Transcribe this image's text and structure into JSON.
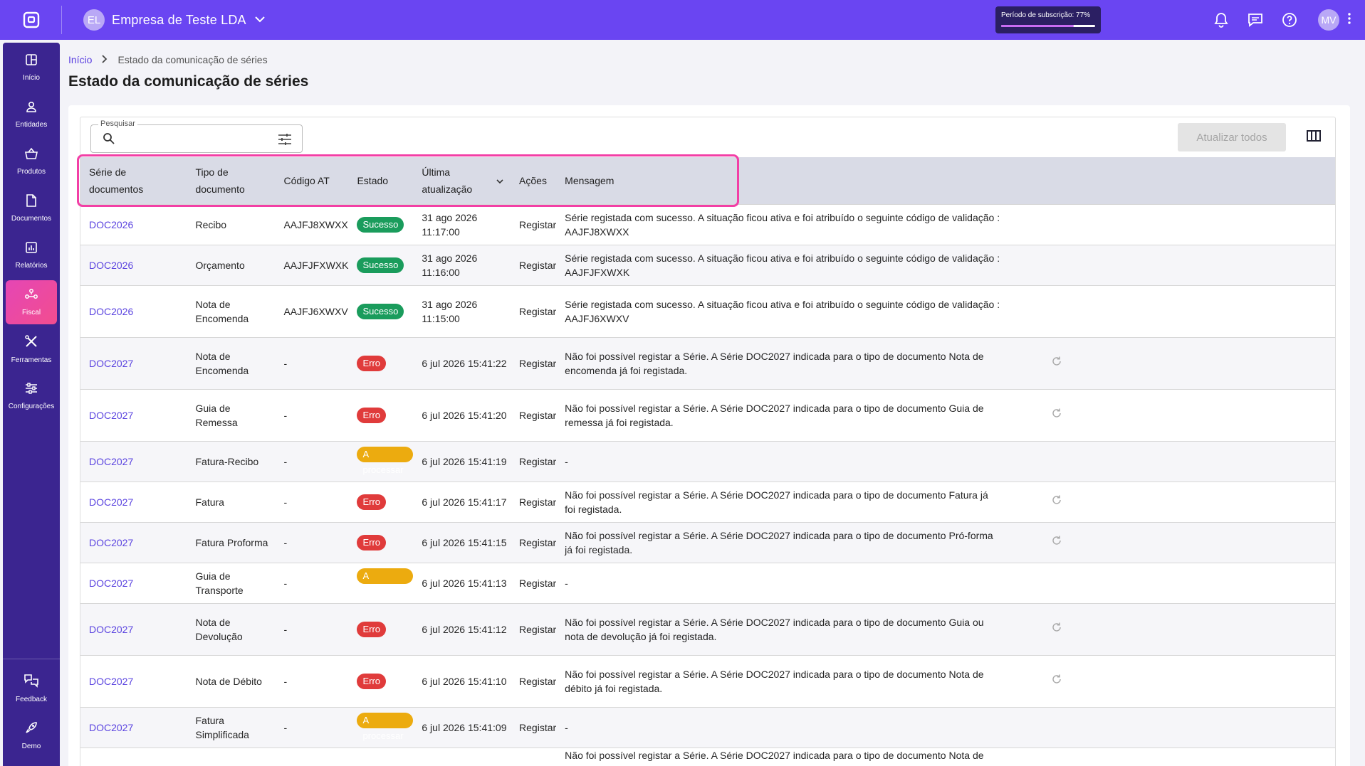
{
  "header": {
    "company_initials": "EL",
    "company_name": "Empresa de Teste LDA",
    "subscription_label": "Período de subscrição: 77%",
    "subscription_progress": 0.77,
    "user_initials": "MV",
    "brand_color": "#6a45f2"
  },
  "sidebar": {
    "items": [
      {
        "label": "Início",
        "icon": "dashboard-icon"
      },
      {
        "label": "Entidades",
        "icon": "person-icon"
      },
      {
        "label": "Produtos",
        "icon": "basket-icon"
      },
      {
        "label": "Documentos",
        "icon": "document-icon"
      },
      {
        "label": "Relatórios",
        "icon": "chart-icon"
      },
      {
        "label": "Fiscal",
        "icon": "fiscal-icon",
        "active": true
      },
      {
        "label": "Ferramentas",
        "icon": "tools-icon"
      },
      {
        "label": "Configurações",
        "icon": "sliders-icon"
      }
    ],
    "bottom": [
      {
        "label": "Feedback",
        "icon": "feedback-icon"
      },
      {
        "label": "Demo",
        "icon": "rocket-icon"
      }
    ]
  },
  "breadcrumb": {
    "home": "Início",
    "current": "Estado da comunicação de séries"
  },
  "page_title": "Estado da comunicação de séries",
  "toolbar": {
    "search_legend": "Pesquisar",
    "search_value": "",
    "update_all_label": "Atualizar todos"
  },
  "table": {
    "headers": {
      "series": "Série de documentos",
      "type": "Tipo de documento",
      "code": "Código AT",
      "status": "Estado",
      "updated": "Última atualização",
      "actions": "Ações",
      "message": "Mensagem"
    },
    "rows": [
      {
        "series": "DOC2026",
        "type": "Recibo",
        "code": "AAJFJ8XWXX",
        "status": "Sucesso",
        "status_kind": "success",
        "updated": "31 ago 2026 11:17:00",
        "action": "Registar",
        "message": "Série registada com sucesso. A situação ficou ativa e foi atribuído o seguinte código de validação : AAJFJ8XWXX",
        "retry": false
      },
      {
        "series": "DOC2026",
        "type": "Orçamento",
        "code": "AAJFJFXWXK",
        "status": "Sucesso",
        "status_kind": "success",
        "updated": "31 ago 2026 11:16:00",
        "action": "Registar",
        "message": "Série registada com sucesso. A situação ficou ativa e foi atribuído o seguinte código de validação : AAJFJFXWXK",
        "retry": false
      },
      {
        "series": "DOC2026",
        "type": "Nota de Encomenda",
        "code": "AAJFJ6XWXV",
        "status": "Sucesso",
        "status_kind": "success",
        "updated": "31 ago 2026 11:15:00",
        "action": "Registar",
        "message": "Série registada com sucesso. A situação ficou ativa e foi atribuído o seguinte código de validação : AAJFJ6XWXV",
        "retry": false
      },
      {
        "series": "DOC2027",
        "type": "Nota de Encomenda",
        "code": "-",
        "status": "Erro",
        "status_kind": "error",
        "updated": "6 jul 2026 15:41:22",
        "action": "Registar",
        "message": "Não foi possível registar a Série. A Série DOC2027 indicada para o tipo de documento Nota de encomenda já foi registada.",
        "retry": true
      },
      {
        "series": "DOC2027",
        "type": "Guia de Remessa",
        "code": "-",
        "status": "Erro",
        "status_kind": "error",
        "updated": "6 jul 2026 15:41:20",
        "action": "Registar",
        "message": "Não foi possível registar a Série. A Série DOC2027 indicada para o tipo de documento Guia de remessa já foi registada.",
        "retry": true
      },
      {
        "series": "DOC2027",
        "type": "Fatura-Recibo",
        "code": "-",
        "status": "A processar",
        "status_kind": "processing",
        "updated": "6 jul 2026 15:41:19",
        "action": "Registar",
        "message": "-",
        "retry": false
      },
      {
        "series": "DOC2027",
        "type": "Fatura",
        "code": "-",
        "status": "Erro",
        "status_kind": "error",
        "updated": "6 jul 2026 15:41:17",
        "action": "Registar",
        "message": "Não foi possível registar a Série. A Série DOC2027 indicada para o tipo de documento Fatura já foi registada.",
        "retry": true
      },
      {
        "series": "DOC2027",
        "type": "Fatura Proforma",
        "code": "-",
        "status": "Erro",
        "status_kind": "error",
        "updated": "6 jul 2026 15:41:15",
        "action": "Registar",
        "message": "Não foi possível registar a Série. A Série DOC2027 indicada para o tipo de documento Pró-forma já foi registada.",
        "retry": true
      },
      {
        "series": "DOC2027",
        "type": "Guia de Transporte",
        "code": "-",
        "status": "A processar",
        "status_kind": "processing",
        "updated": "6 jul 2026 15:41:13",
        "action": "Registar",
        "message": "-",
        "retry": false
      },
      {
        "series": "DOC2027",
        "type": "Nota de Devolução",
        "code": "-",
        "status": "Erro",
        "status_kind": "error",
        "updated": "6 jul 2026 15:41:12",
        "action": "Registar",
        "message": "Não foi possível registar a Série. A Série DOC2027 indicada para o tipo de documento Guia ou nota de devolução já foi registada.",
        "retry": true
      },
      {
        "series": "DOC2027",
        "type": "Nota de Débito",
        "code": "-",
        "status": "Erro",
        "status_kind": "error",
        "updated": "6 jul 2026 15:41:10",
        "action": "Registar",
        "message": "Não foi possível registar a Série. A Série DOC2027 indicada para o tipo de documento Nota de débito já foi registada.",
        "retry": true
      },
      {
        "series": "DOC2027",
        "type": "Fatura Simplificada",
        "code": "-",
        "status": "A processar",
        "status_kind": "processing",
        "updated": "6 jul 2026 15:41:09",
        "action": "Registar",
        "message": "-",
        "retry": false
      },
      {
        "series": "",
        "type": "",
        "code": "",
        "status": "",
        "status_kind": "error",
        "updated": "",
        "action": "",
        "message": "Não foi possível registar a Série. A Série DOC2027 indicada para o tipo de documento Nota de crédito já foi",
        "retry": false
      }
    ]
  }
}
